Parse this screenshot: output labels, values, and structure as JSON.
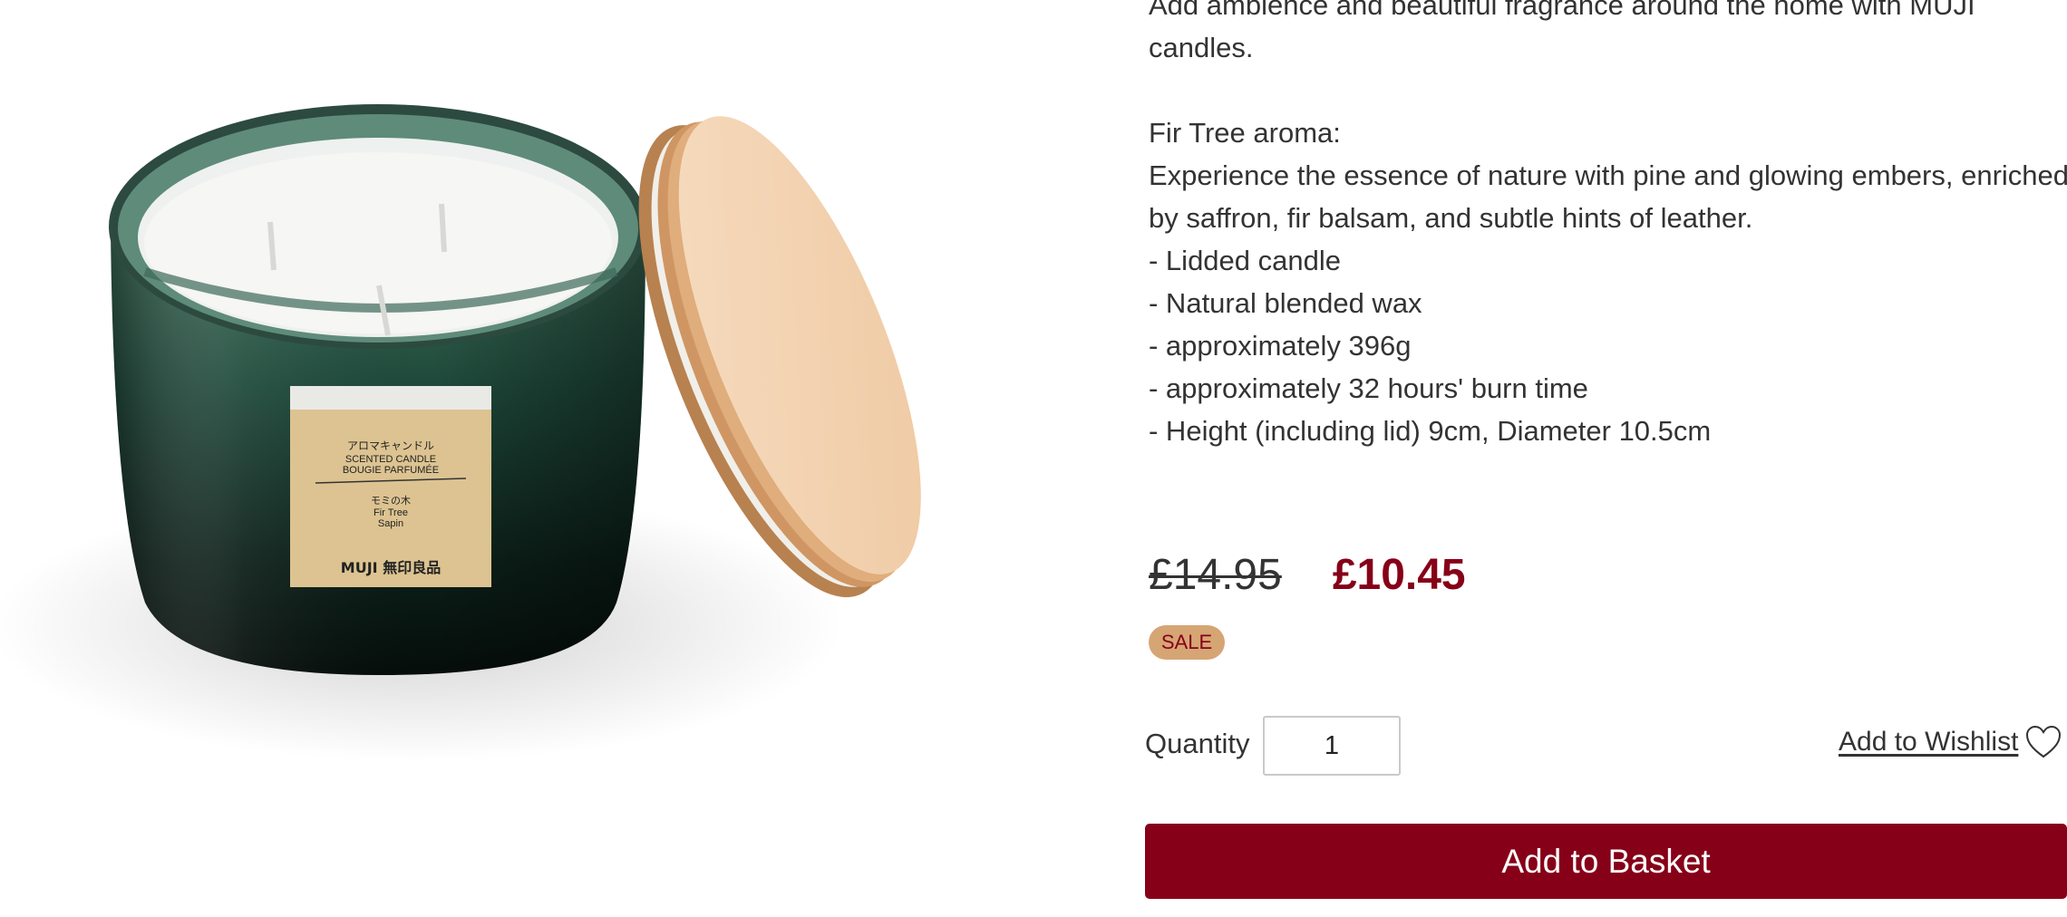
{
  "product": {
    "description_lines": [
      "Add ambience and beautiful fragrance around the home with MUJI",
      "candles.",
      "",
      "Fir Tree aroma:",
      "Experience the essence of nature with pine and glowing embers, enriched",
      "by saffron, fir balsam, and subtle hints of leather.",
      "- Lidded candle",
      "- Natural blended wax",
      "- approximately 396g",
      "- approximately 32 hours' burn time",
      "- Height (including lid) 9cm, Diameter 10.5cm"
    ],
    "image_label": {
      "line1": "アロマキャンドル",
      "line2": "SCENTED CANDLE",
      "line3": "BOUGIE PARFUMÉE",
      "line4": "モミの木",
      "line5": "Fir Tree",
      "line6": "Sapin",
      "brand": "MUJI 無印良品"
    }
  },
  "pricing": {
    "original_price": "£14.95",
    "sale_price": "£10.45",
    "badge": "SALE"
  },
  "purchase": {
    "quantity_label": "Quantity",
    "quantity_value": "1",
    "wishlist_label": "Add to Wishlist",
    "add_to_basket_label": "Add to Basket"
  },
  "colors": {
    "brand_accent": "#860018",
    "sale_badge_bg": "#d6a574",
    "text": "#333333"
  },
  "icons": {
    "wishlist": "heart-icon"
  }
}
